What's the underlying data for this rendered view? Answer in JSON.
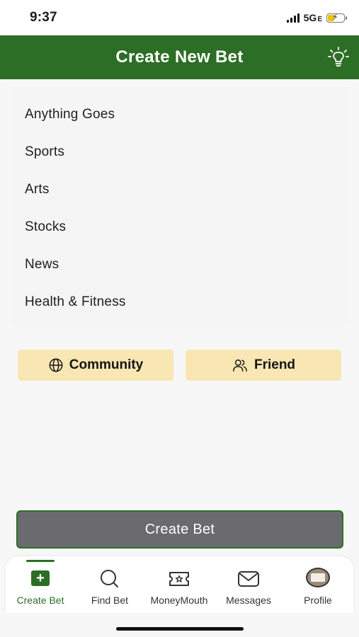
{
  "status_bar": {
    "time": "9:37",
    "network": "5G",
    "network_suffix": "E"
  },
  "header": {
    "title": "Create New Bet",
    "icon": "lightbulb-icon"
  },
  "categories": [
    {
      "label": "Anything Goes"
    },
    {
      "label": "Sports"
    },
    {
      "label": "Arts"
    },
    {
      "label": "Stocks"
    },
    {
      "label": "News"
    },
    {
      "label": "Health & Fitness"
    }
  ],
  "audience": {
    "community_label": "Community",
    "friend_label": "Friend"
  },
  "create_button": {
    "label": "Create Bet"
  },
  "tabbar": {
    "tabs": [
      {
        "label": "Create Bet",
        "icon": "plus-square-icon",
        "active": true
      },
      {
        "label": "Find Bet",
        "icon": "search-icon",
        "active": false
      },
      {
        "label": "MoneyMouth",
        "icon": "ticket-icon",
        "active": false
      },
      {
        "label": "Messages",
        "icon": "envelope-icon",
        "active": false
      },
      {
        "label": "Profile",
        "icon": "avatar",
        "active": false
      }
    ]
  },
  "colors": {
    "brand_green": "#2c6e25",
    "chip_background": "#f8e6b3",
    "button_gray": "#6b6b6f"
  }
}
